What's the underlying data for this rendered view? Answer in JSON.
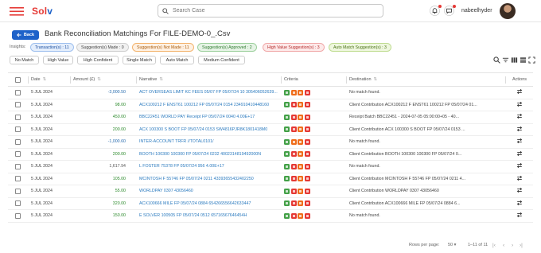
{
  "header": {
    "logo_text": "Solv",
    "search_placeholder": "Search Case",
    "username": "nabeelhyder",
    "icons": [
      "search-icon",
      "bell-icon",
      "chat-icon",
      "avatar"
    ]
  },
  "page": {
    "back_label": "Back",
    "title": "Bank Reconciliation Matchings For FILE-DEMO-0_.Csv"
  },
  "insights": {
    "label": "Insights:",
    "pills": [
      {
        "label": "Transaction(s) : 11",
        "tone": "blue"
      },
      {
        "label": "Suggestion(s) Made : 0",
        "tone": "grey"
      },
      {
        "label": "Suggestion(s) Not Made : 11",
        "tone": "orange"
      },
      {
        "label": "Suggestion(s) Approved : 2",
        "tone": "green"
      },
      {
        "label": "High Value Suggestion(s) : 3",
        "tone": "red"
      },
      {
        "label": "Auto Match Suggestion(s) : 3",
        "tone": "lime"
      }
    ]
  },
  "filters": [
    "No Match",
    "High Value",
    "High Confident",
    "Single Match",
    "Auto Match",
    "Medium Confident"
  ],
  "table": {
    "headers": {
      "date": "Date",
      "amount": "Amount (£)",
      "narrative": "Narrative",
      "criteria": "Criteria",
      "destination": "Destination",
      "actions": "Actions"
    },
    "rows": [
      {
        "date": "5 JUL 2024",
        "amount": "-3,000.50",
        "tone": "neg",
        "narrative": "ACT OVERSEAS LIMIT KC FEES 05/07 FP 05/07/24 10 305406052639...",
        "criteria": [
          "g",
          "o",
          "o",
          "r"
        ],
        "destination": "No match found."
      },
      {
        "date": "5 JUL 2024",
        "amount": "98.00",
        "tone": "pos",
        "narrative": "ACX100212 F ENST61 100212 FP 05/07/24 0154 234910410448160",
        "criteria": [
          "g",
          "r",
          "o",
          "r"
        ],
        "destination": "Client Contribution ACX100212 F ENST61 100212 FP 05/07/24 01..."
      },
      {
        "date": "5 JUL 2024",
        "amount": "450.00",
        "tone": "pos",
        "narrative": "BBC22451 WORLD PAY Receipt FP 05/07/24 0040 4.00E+17",
        "criteria": [
          "g",
          "r",
          "o",
          "r"
        ],
        "destination": "Receipt Batch BBC22451 - 2024-07-05 05:00:00+05 - 40..."
      },
      {
        "date": "5 JUL 2024",
        "amount": "200.00",
        "tone": "pos",
        "narrative": "ACX 100300 S BOOT FP 05/07/24 0153 SW4816PJR8K1801418M0",
        "criteria": [
          "g",
          "r",
          "o",
          "r"
        ],
        "destination": "Client Contribution ACX 100300 S BOOT FP 05/07/24 0153 ..."
      },
      {
        "date": "5 JUL 2024",
        "amount": "-1,000.60",
        "tone": "neg",
        "narrative": "INTER-ACCOUNT TRFR //TOTAL0101/",
        "criteria": [
          "g",
          "o",
          "o",
          "r"
        ],
        "destination": "No match found."
      },
      {
        "date": "5 JUL 2024",
        "amount": "200.00",
        "tone": "pos",
        "narrative": "BOOTH 100300 100300 FP 05/07/24 0232 4002314819492000N",
        "criteria": [
          "g",
          "r",
          "o",
          "r"
        ],
        "destination": "Client Contribution BOOTH 100300 100300 FP 05/07/24 0..."
      },
      {
        "date": "5 JUL 2024",
        "amount": "1,617.94",
        "tone": "neu",
        "narrative": "L FOSTER 75378 FP 05/07/24 956 4.00E+17",
        "criteria": [
          "g",
          "r",
          "o",
          "r"
        ],
        "destination": "No match found."
      },
      {
        "date": "5 JUL 2024",
        "amount": "105.00",
        "tone": "pos",
        "narrative": "MCINTOSH F 55746 FP 05/07/24 0211 43393655432402250",
        "criteria": [
          "g",
          "r",
          "o",
          "r"
        ],
        "destination": "Client Contribution MCINTOSH F 55746 FP 05/07/24 0211 4..."
      },
      {
        "date": "5 JUL 2024",
        "amount": "55.00",
        "tone": "pos",
        "narrative": "WORLDPAY 0307 43056460",
        "criteria": [
          "g",
          "r",
          "o",
          "r"
        ],
        "destination": "Client Contribution WORLDPAY 0307 43056460"
      },
      {
        "date": "5 JUL 2024",
        "amount": "320.00",
        "tone": "pos",
        "narrative": "ACX100666 MILE FP 05/07/24 0884 654266556642633447",
        "criteria": [
          "g",
          "r",
          "o",
          "r"
        ],
        "destination": "Client Contribution ACX100666 MILE FP 05/07/24 0884 6..."
      },
      {
        "date": "5 JUL 2024",
        "amount": "150.00",
        "tone": "pos",
        "narrative": "E SOLVER 100505 FP 05/07/24 0512 65716567646454H",
        "criteria": [
          "g",
          "r",
          "o",
          "r"
        ],
        "destination": "No match found."
      }
    ]
  },
  "pagination": {
    "rows_per_page_label": "Rows per page:",
    "rows_per_page_value": "50",
    "range": "1–11 of 11"
  }
}
